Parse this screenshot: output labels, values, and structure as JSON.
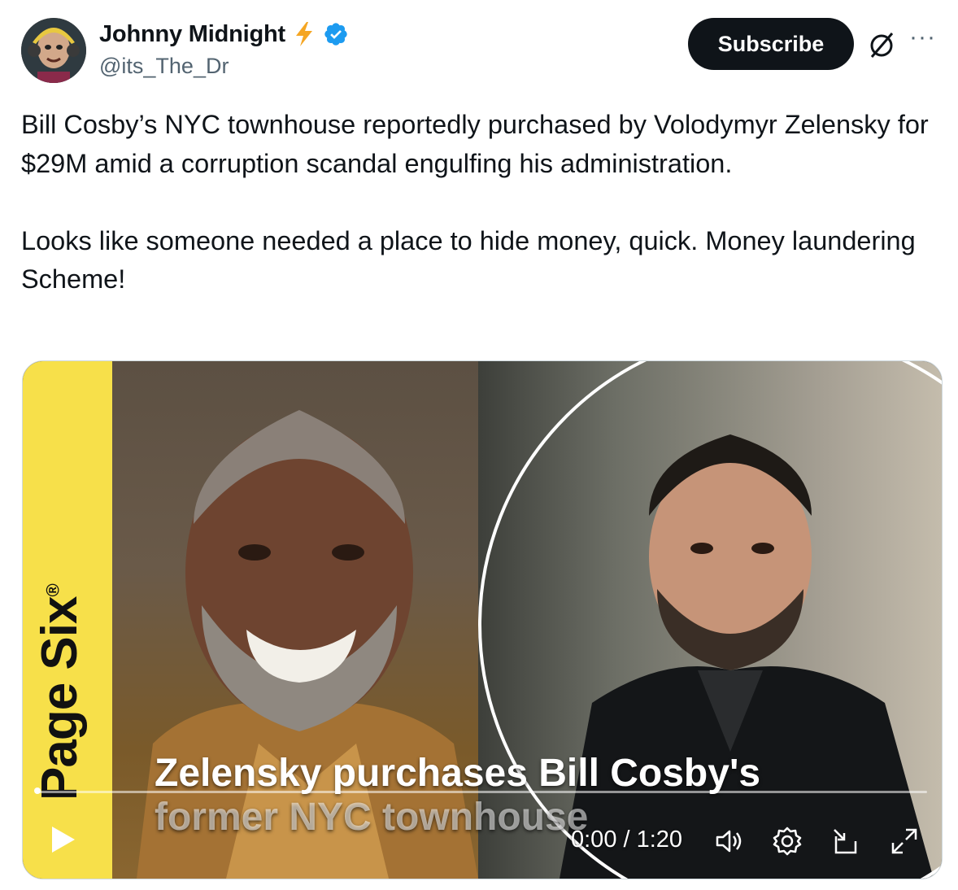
{
  "author": {
    "name": "Johnny Midnight",
    "badge": "⚡",
    "handle": "@its_The_Dr",
    "verified": true
  },
  "actions": {
    "subscribe_label": "Subscribe",
    "grok_icon": "grok-icon",
    "more_label": "···"
  },
  "tweet": {
    "paragraph1": "Bill Cosby’s NYC townhouse reportedly purchased by Volodymyr Zelensky for $29M amid a corruption scandal engulfing his administration.",
    "paragraph2": "Looks like someone needed a place to hide money, quick. Money laundering Scheme!"
  },
  "video": {
    "brand": "Page Six",
    "brand_mark": "®",
    "caption_line1": "Zelensky purchases Bill Cosby's",
    "caption_line2": "former NYC townhouse",
    "time": "0:00 / 1:20",
    "progress": 0,
    "icons": [
      "play-icon",
      "volume-icon",
      "settings-icon",
      "pip-icon",
      "fullscreen-icon"
    ]
  },
  "colors": {
    "text": "#0f1419",
    "secondary": "#536471",
    "verified": "#1d9bf0",
    "bolt": "#f5a623",
    "brand_yellow": "#f7e04a"
  }
}
